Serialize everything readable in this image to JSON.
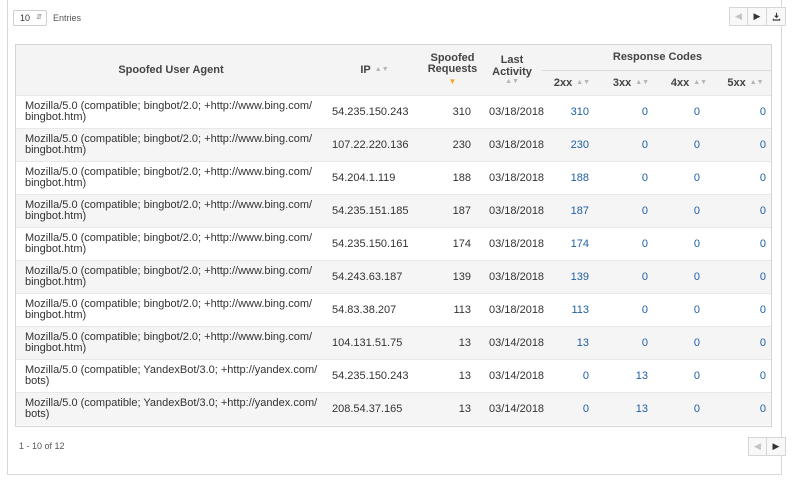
{
  "controls": {
    "page_size": "10",
    "entries_label": "Entries"
  },
  "icons": {
    "prev": "chevron-left-icon",
    "next": "chevron-right-icon",
    "download": "download-icon"
  },
  "table": {
    "headers": {
      "user_agent": "Spoofed User Agent",
      "ip": "IP",
      "requests_line1": "Spoofed",
      "requests_line2": "Requests",
      "last_activity": "Last Activity",
      "response_codes": "Response Codes",
      "c2xx": "2xx",
      "c3xx": "3xx",
      "c4xx": "4xx",
      "c5xx": "5xx"
    },
    "rows": [
      {
        "ua": "Mozilla/5.0 (compatible; bingbot/2.0; +http://www.bing.com/bingbot.htm)",
        "ip": "54.235.150.243",
        "requests": "310",
        "last": "03/18/2018",
        "c2": "310",
        "c3": "0",
        "c4": "0",
        "c5": "0"
      },
      {
        "ua": "Mozilla/5.0 (compatible; bingbot/2.0; +http://www.bing.com/bingbot.htm)",
        "ip": "107.22.220.136",
        "requests": "230",
        "last": "03/18/2018",
        "c2": "230",
        "c3": "0",
        "c4": "0",
        "c5": "0"
      },
      {
        "ua": "Mozilla/5.0 (compatible; bingbot/2.0; +http://www.bing.com/bingbot.htm)",
        "ip": "54.204.1.119",
        "requests": "188",
        "last": "03/18/2018",
        "c2": "188",
        "c3": "0",
        "c4": "0",
        "c5": "0"
      },
      {
        "ua": "Mozilla/5.0 (compatible; bingbot/2.0; +http://www.bing.com/bingbot.htm)",
        "ip": "54.235.151.185",
        "requests": "187",
        "last": "03/18/2018",
        "c2": "187",
        "c3": "0",
        "c4": "0",
        "c5": "0"
      },
      {
        "ua": "Mozilla/5.0 (compatible; bingbot/2.0; +http://www.bing.com/bingbot.htm)",
        "ip": "54.235.150.161",
        "requests": "174",
        "last": "03/18/2018",
        "c2": "174",
        "c3": "0",
        "c4": "0",
        "c5": "0"
      },
      {
        "ua": "Mozilla/5.0 (compatible; bingbot/2.0; +http://www.bing.com/bingbot.htm)",
        "ip": "54.243.63.187",
        "requests": "139",
        "last": "03/18/2018",
        "c2": "139",
        "c3": "0",
        "c4": "0",
        "c5": "0"
      },
      {
        "ua": "Mozilla/5.0 (compatible; bingbot/2.0; +http://www.bing.com/bingbot.htm)",
        "ip": "54.83.38.207",
        "requests": "113",
        "last": "03/18/2018",
        "c2": "113",
        "c3": "0",
        "c4": "0",
        "c5": "0"
      },
      {
        "ua": "Mozilla/5.0 (compatible; bingbot/2.0; +http://www.bing.com/bingbot.htm)",
        "ip": "104.131.51.75",
        "requests": "13",
        "last": "03/14/2018",
        "c2": "13",
        "c3": "0",
        "c4": "0",
        "c5": "0"
      },
      {
        "ua": "Mozilla/5.0 (compatible; YandexBot/3.0; +http://yandex.com/bots)",
        "ip": "54.235.150.243",
        "requests": "13",
        "last": "03/14/2018",
        "c2": "0",
        "c3": "13",
        "c4": "0",
        "c5": "0"
      },
      {
        "ua": "Mozilla/5.0 (compatible; YandexBot/3.0; +http://yandex.com/bots)",
        "ip": "208.54.37.165",
        "requests": "13",
        "last": "03/14/2018",
        "c2": "0",
        "c3": "13",
        "c4": "0",
        "c5": "0"
      }
    ]
  },
  "footer": {
    "range": "1 - 10 of 12"
  },
  "colors": {
    "link": "#1f5fa3",
    "sort_active": "#f5a623",
    "header_bg": "#f4f4f4",
    "stripe_bg": "#f5f5f5"
  }
}
